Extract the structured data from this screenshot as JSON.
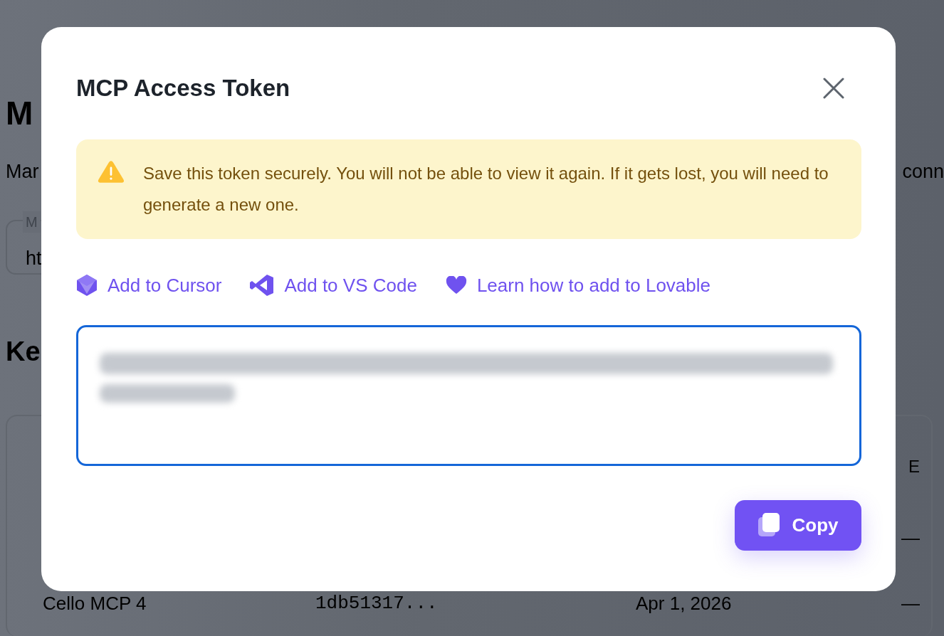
{
  "background_page": {
    "heading": "M",
    "description_start": "Mar",
    "description_end": "conn",
    "field": {
      "label": "M",
      "value": "ht"
    },
    "section_heading": "Ke",
    "table": {
      "column_header": "E",
      "rows": [
        {
          "column_4": "—"
        },
        {
          "name": "Cello MCP 4",
          "key": "1db51317...",
          "date": "Apr 1, 2026",
          "column_4": "—"
        }
      ]
    }
  },
  "dialog": {
    "title": "MCP Access Token",
    "warning": "Save this token securely. You will not be able to view it again. If it gets lost, you will need to generate a new one.",
    "links": [
      {
        "kind": "cube",
        "label": "Add to Cursor"
      },
      {
        "kind": "vscode",
        "label": "Add to VS Code"
      },
      {
        "kind": "heart",
        "label": "Learn how to add to Lovable"
      }
    ],
    "token_redacted": true,
    "copy_button": "Copy"
  }
}
